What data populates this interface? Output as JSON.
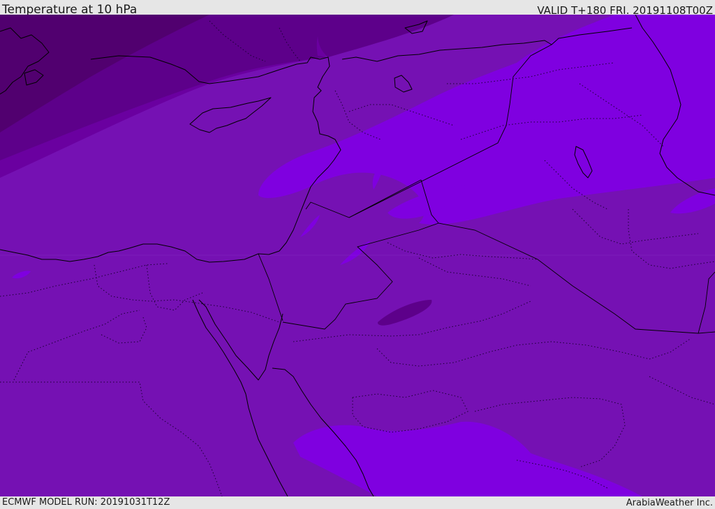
{
  "header": {
    "title": "Temperature at 10 hPa",
    "valid": "VALID T+180 FRI. 20191108T00Z"
  },
  "footer": {
    "model_run": "ECMWF MODEL RUN: 20191031T12Z",
    "credit": "ArabiaWeather Inc."
  },
  "map": {
    "field": "temperature",
    "level": "10 hPa",
    "colors": {
      "darkest": "#51006f",
      "darker": "#5d008a",
      "dark": "#6a00a0",
      "base": "#7511b3",
      "light": "#7f00e0",
      "coastline": "#000000"
    }
  }
}
